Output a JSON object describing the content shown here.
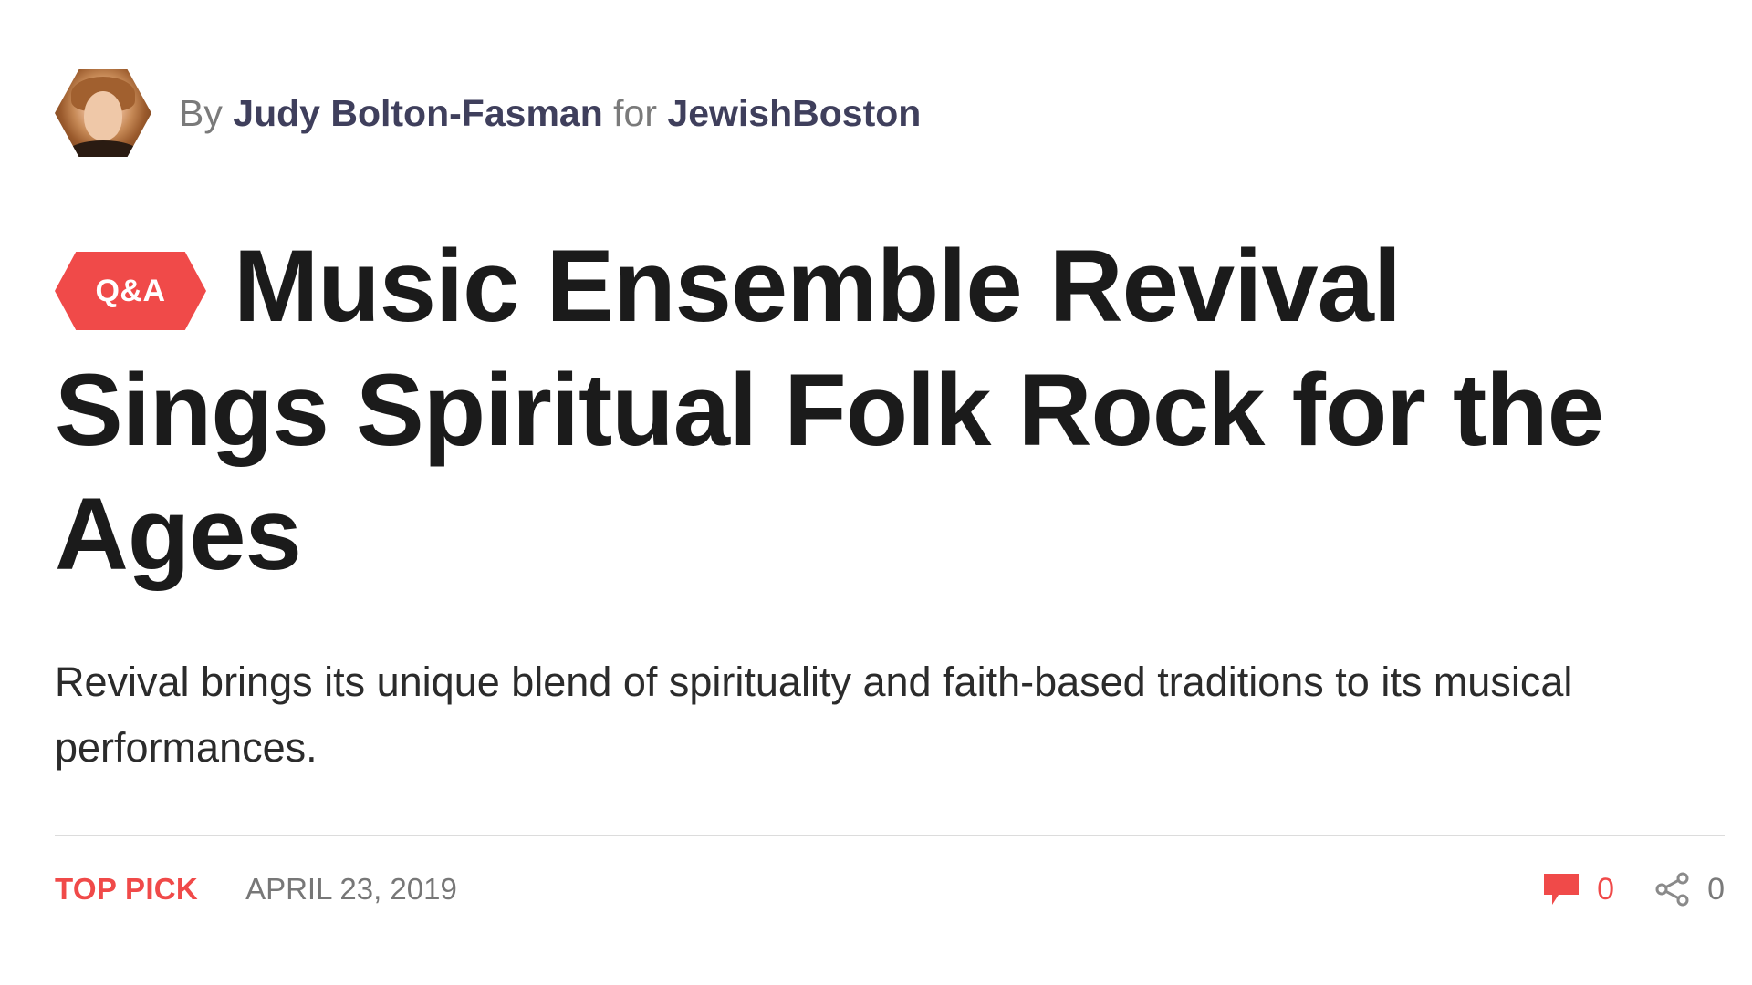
{
  "byline": {
    "by": "By",
    "author": "Judy Bolton-Fasman",
    "for": "for",
    "publication": "JewishBoston"
  },
  "article": {
    "badge": "Q&A",
    "title": "Music Ensemble Revival Sings Spiritual Folk Rock for the Ages",
    "dek": "Revival brings its unique blend of spirituality and faith-based traditions to its musical performances."
  },
  "meta": {
    "tag": "TOP PICK",
    "date": "APRIL 23, 2019",
    "comment_count": "0",
    "share_count": "0"
  },
  "icons": {
    "comment": "comment-icon",
    "share": "share-icon"
  },
  "colors": {
    "accent": "#f04a49",
    "author": "#3f3f5c",
    "muted": "#7a7a7a"
  }
}
